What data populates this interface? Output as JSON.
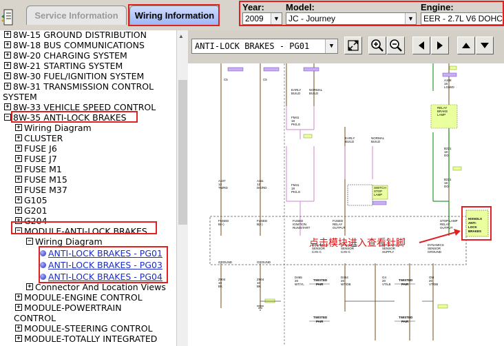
{
  "tabs": {
    "service": "Service Information",
    "wiring": "Wiring Information"
  },
  "selectors": {
    "year": {
      "label": "Year:",
      "value": "2009"
    },
    "model": {
      "label": "Model:",
      "value": "JC - Journey"
    },
    "engine": {
      "label": "Engine:",
      "value": "EER - 2.7L V6 DOHC"
    }
  },
  "tree": {
    "items": [
      {
        "label": "8W-15 GROUND DISTRIBUTION",
        "expander": "+"
      },
      {
        "label": "8W-18 BUS COMMUNICATIONS",
        "expander": "+"
      },
      {
        "label": "8W-20 CHARGING SYSTEM",
        "expander": "+"
      },
      {
        "label": "8W-21 STARTING SYSTEM",
        "expander": "+"
      },
      {
        "label": "8W-30 FUEL/IGNITION SYSTEM",
        "expander": "+"
      },
      {
        "label": "8W-31 TRANSMISSION CONTROL",
        "label2": "SYSTEM",
        "expander": "+"
      },
      {
        "label": "8W-33 VEHICLE SPEED CONTROL",
        "expander": "+"
      },
      {
        "label": "8W-35 ANTI-LOCK BRAKES",
        "expander": "-"
      },
      {
        "label": "Wiring Diagram",
        "expander": "+"
      },
      {
        "label": "CLUSTER",
        "expander": "+"
      },
      {
        "label": "FUSE J6",
        "expander": "+"
      },
      {
        "label": "FUSE J7",
        "expander": "+"
      },
      {
        "label": "FUSE M1",
        "expander": "+"
      },
      {
        "label": "FUSE M15",
        "expander": "+"
      },
      {
        "label": "FUSE M37",
        "expander": "+"
      },
      {
        "label": "G105",
        "expander": "+"
      },
      {
        "label": "G201",
        "expander": "+"
      },
      {
        "label": "G204",
        "expander": "+"
      },
      {
        "label": "MODULE-ANTI-LOCK BRAKES",
        "expander": "-"
      },
      {
        "label": "Wiring Diagram",
        "expander": "-"
      },
      {
        "label": "ANTI-LOCK BRAKES - PG01"
      },
      {
        "label": "ANTI-LOCK BRAKES - PG03"
      },
      {
        "label": "ANTI-LOCK BRAKES - PG04"
      },
      {
        "label": "Connector And Location Views",
        "expander": "+"
      },
      {
        "label": "MODULE-ENGINE CONTROL",
        "expander": "+"
      },
      {
        "label": "MODULE-POWERTRAIN",
        "label2": "CONTROL",
        "expander": "+"
      },
      {
        "label": "MODULE-STEERING CONTROL",
        "expander": "+"
      },
      {
        "label": "MODULE-TOTALLY INTEGRATED",
        "expander": "+"
      }
    ]
  },
  "toolbar": {
    "page": "ANTI-LOCK BRAKES - PG01"
  },
  "diagram": {
    "annotation_cn": "点击模块进入查看针脚",
    "module_label": "MODULE-ANTI-LOCK BRAKES",
    "labels": {
      "early_build": "EARLY BUILD",
      "normal_build": "NORMAL BUILD",
      "fused_b1": "FUSED B(+)",
      "fused_b2": "FUSED B(+)",
      "fused_ign": "FUSED IGNITION RUN/START RELAY OUTPUT",
      "fused_ign2": "FUSED RELAY OUTPUT",
      "stop_lamp": "STOP LAMP RELAY OUTPUT",
      "ground1": "GROUND",
      "ground2": "GROUND",
      "dyn1": "DYNAMICS SENSOR CAN C BUS (+)",
      "dyn2": "DYNAMICS SENSOR CAN C BUS (-)",
      "dyn3": "DYNAMICS SENSOR SUPPLY",
      "dyn4": "DYNAMICS SENSOR GROUND",
      "twisted1": "TWISTED PAIR",
      "twisted2": "TWISTED PAIR",
      "twisted3": "TWISTED PAIR",
      "twisted4": "TWISTED PAIR",
      "relay_brake": "RELAY BRAKE LAMP",
      "switch_stop": "SWITCH STOP LAMP",
      "c5": "C5",
      "c113": "C113",
      "w_fm1": "FM41 18 PK/LG",
      "w_a107": "A107 12 TN/RD",
      "w_a111": "A111 12 DG/RD",
      "w_z904": "Z904 10 BK",
      "w_d464": "D464 20 WT/DB",
      "w_d465": "D465 20 WT/YL",
      "w_g4": "G4 20 VT/LB",
      "w_gm": "GM 20 VT/DB",
      "w_b221": "B221 18 DG",
      "w_a108": "A108 18 LG/WD",
      "g120": "G120",
      "c112": "C112",
      "hook": "HIXNOLS ANTI-LOCK BRAKES"
    }
  },
  "colors": {
    "highlight": "#e02020",
    "link": "#1a2cc9",
    "tab_active": "#9eb6f5",
    "module_fill": "#eaff9e"
  }
}
